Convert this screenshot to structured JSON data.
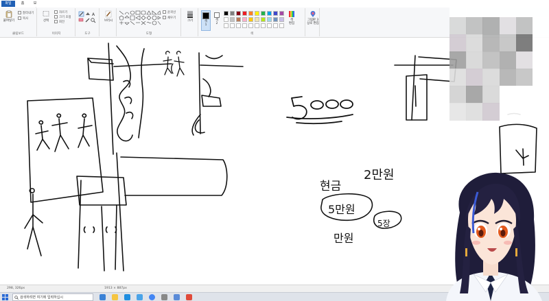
{
  "menu": {
    "file": "파일",
    "home": "홈",
    "view": "보기"
  },
  "ribbon": {
    "clipboard": {
      "paste": "붙여넣기",
      "cut": "잘라내기",
      "copy": "복사",
      "label": "클립보드"
    },
    "image": {
      "select": "선택",
      "crop": "자르기",
      "resize": "크기 조정",
      "rotate": "회전",
      "label": "이미지"
    },
    "tools": {
      "label": "도구"
    },
    "brushes": {
      "name": "브러시",
      "label": ""
    },
    "shapes": {
      "outline": "윤곽선",
      "fill": "채우기",
      "label": "도형"
    },
    "size": {
      "name": "크기"
    },
    "colors": {
      "color1": "색\n1",
      "color2": "색\n2",
      "edit": "색\n편집",
      "paint3d": "그림판 3\n상로 편집",
      "label": "색",
      "palette": [
        "#000000",
        "#7f7f7f",
        "#880015",
        "#ed1c24",
        "#ff7f27",
        "#fff200",
        "#22b14c",
        "#00a2e8",
        "#3f48cc",
        "#a349a4",
        "#ffffff",
        "#c3c3c3",
        "#b97a57",
        "#ffaec9",
        "#ffc90e",
        "#efe4b0",
        "#b5e61d",
        "#99d9ea",
        "#7092be",
        "#c8bfe7",
        "#ffffff",
        "#ffffff",
        "#ffffff",
        "#ffffff",
        "#ffffff",
        "#ffffff",
        "#ffffff",
        "#ffffff",
        "#ffffff",
        "#ffffff"
      ]
    }
  },
  "canvas_text": {
    "number": "5000",
    "hangul1": "2만원",
    "hangul2": "현금",
    "hangul3": "5만원",
    "hangul4": "5장",
    "hangul5": "만원"
  },
  "status": {
    "coords": "298, 326px",
    "size": "1913 × 887px"
  },
  "taskbar": {
    "search": "검색하려면 여기에 입력하십시"
  },
  "colors": {
    "accent": "#1f5fb5",
    "ribbon_bg": "#f6f7f9"
  }
}
